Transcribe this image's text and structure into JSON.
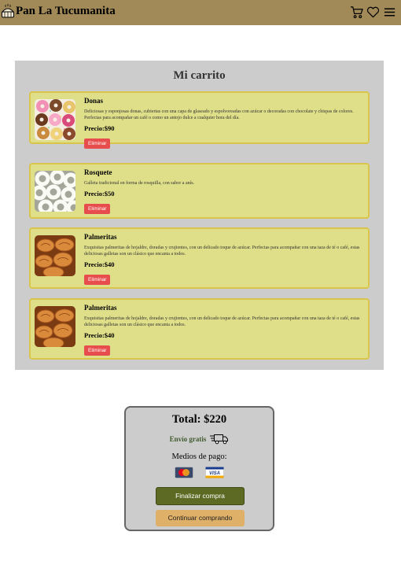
{
  "header": {
    "brand_name": "Pan La Tucumanita",
    "logo_icon": "bread-basket-icon",
    "icons": [
      "cart-icon",
      "heart-icon",
      "menu-icon"
    ],
    "background_color": "#a18a58"
  },
  "cart": {
    "title": "Mi carrito",
    "items": [
      {
        "name": "Donas",
        "description": "Deliciosas y esponjosas donas, cubiertas con una capa de glaseado y espolvoreadas con azúcar o decoradas con chocolate y chispas de colores. Perfectas para acompañar un café o como un antojo dulce a cualquier hora del día.",
        "price": "Precio:$90",
        "remove_label": "Eliminar",
        "image_icon": "donuts-image"
      },
      {
        "name": "Rosquete",
        "description": "Galleta tradicional en forma de rosquilla, con sabor a anís.",
        "price": "Precio:$50",
        "remove_label": "Eliminar",
        "image_icon": "rosquete-image"
      },
      {
        "name": "Palmeritas",
        "description": "Exquisitas palmeritas de hojaldre, doradas y crujientes, con un delicado toque de azúcar. Perfectas para acompañar con una taza de té o café, estas deliciosas galletas son un clásico que encanta a todos.",
        "price": "Precio:$40",
        "remove_label": "Eliminar",
        "image_icon": "palmeritas-image"
      },
      {
        "name": "Palmeritas",
        "description": "Exquisitas palmeritas de hojaldre, doradas y crujientes, con un delicado toque de azúcar. Perfectas para acompañar con una taza de té o café, estas deliciosas galletas son un clásico que encanta a todos.",
        "price": "Precio:$40",
        "remove_label": "Eliminar",
        "image_icon": "palmeritas-image"
      }
    ]
  },
  "summary": {
    "total": "Total: $220",
    "shipping_label": "Envío gratis",
    "payment_label": "Medios de pago:",
    "cards": [
      "mastercard-icon",
      "visa-icon"
    ],
    "finish_button": "Finalizar compra",
    "continue_button": "Continuar comprando"
  }
}
